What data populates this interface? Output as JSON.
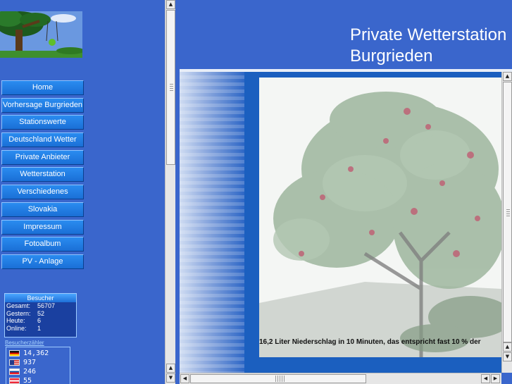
{
  "nav": {
    "items": [
      "Home",
      "Vorhersage Burgrieden",
      "Stationswerte",
      "Deutschland Wetter",
      "Private Anbieter",
      "Wetterstation",
      "Verschiedenes",
      "Slovakia",
      "Impressum",
      "Fotoalbum",
      "PV - Anlage"
    ]
  },
  "counter": {
    "title": "Besucher",
    "rows": [
      {
        "label": "Gesamt:",
        "value": "56707"
      },
      {
        "label": "Gestern:",
        "value": "52"
      },
      {
        "label": "Heute:",
        "value": "6"
      },
      {
        "label": "Online:",
        "value": "1"
      }
    ]
  },
  "flag_counter": {
    "link": "Besucherzähler",
    "entries": [
      {
        "country": "germany-flag",
        "value": "14,362"
      },
      {
        "country": "usa-flag",
        "value": "937"
      },
      {
        "country": "slovakia-flag",
        "value": "246"
      },
      {
        "country": "austria-flag",
        "value": "55"
      }
    ]
  },
  "header": {
    "title_line1": "Private Wetterstation",
    "title_line2": "Burgrieden"
  },
  "photo": {
    "caption": "16,2 Liter Niederschlag in 10 Minuten, das entspricht fast 10 % der"
  },
  "icons": {
    "scroll_up": "triangle-up-icon",
    "scroll_down": "triangle-down-icon",
    "scroll_left": "triangle-left-icon",
    "scroll_right": "triangle-right-icon"
  },
  "colors": {
    "background": "#3a66cc",
    "nav_button": "#1a6fd6",
    "content_panel": "#1b5fbf"
  }
}
